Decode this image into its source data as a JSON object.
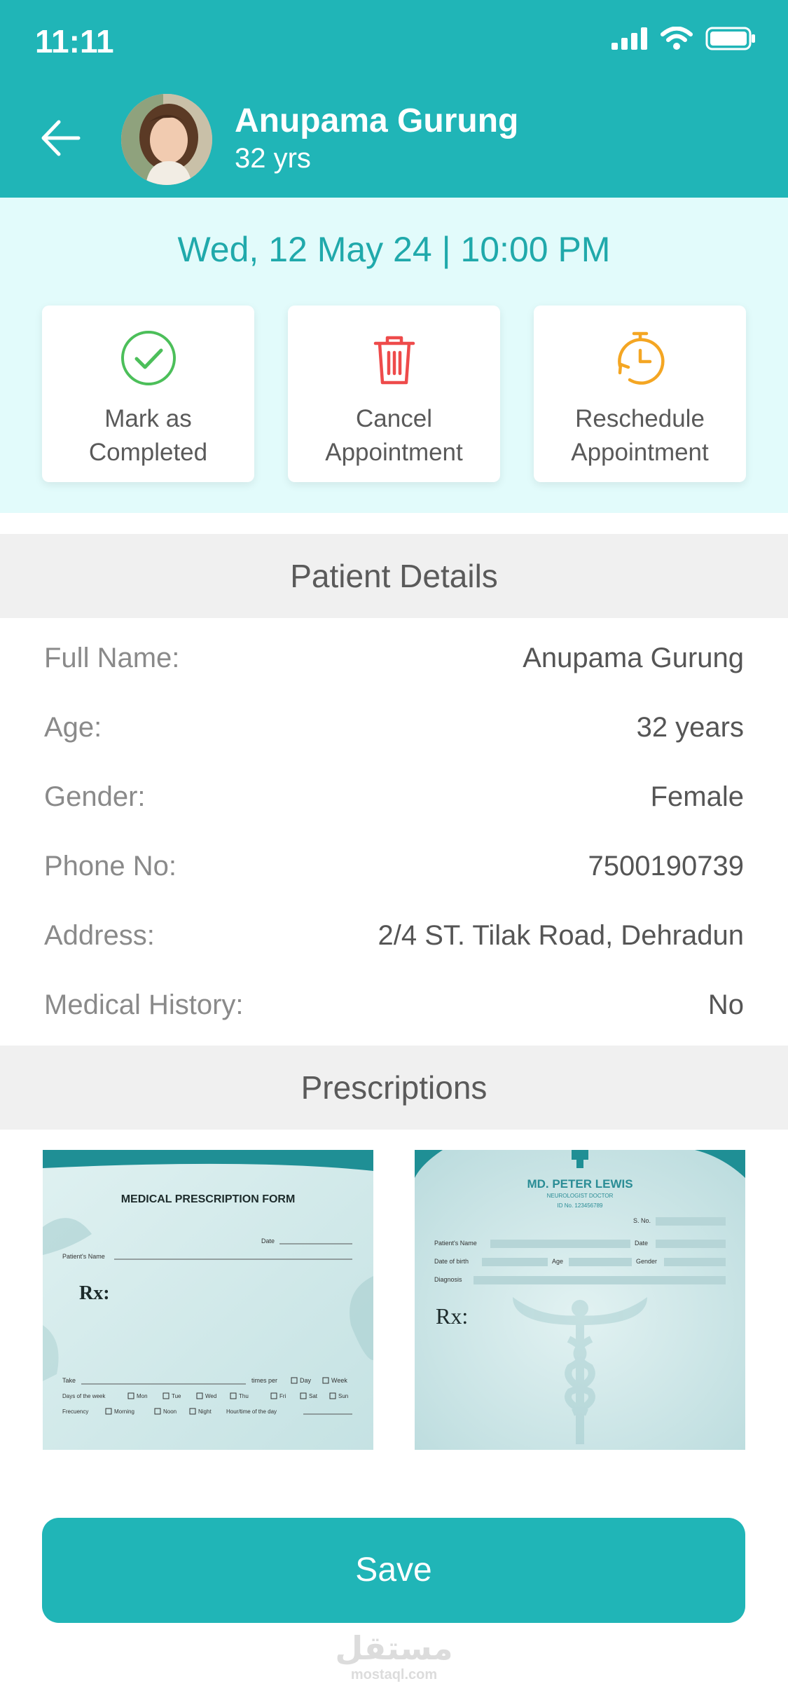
{
  "status_bar": {
    "time": "11:11"
  },
  "header": {
    "patient_name": "Anupama Gurung",
    "patient_age": "32 yrs"
  },
  "appointment": {
    "datetime": "Wed, 12 May 24 | 10:00 PM",
    "actions": [
      {
        "line1": "Mark as",
        "line2": "Completed",
        "icon": "check-circle-icon",
        "color": "#4cbf5a"
      },
      {
        "line1": "Cancel",
        "line2": "Appointment",
        "icon": "trash-icon",
        "color": "#ee4b4b"
      },
      {
        "line1": "Reschedule",
        "line2": "Appointment",
        "icon": "clock-reschedule-icon",
        "color": "#f4a623"
      }
    ]
  },
  "patient_details": {
    "title": "Patient Details",
    "rows": [
      {
        "label": "Full Name:",
        "value": "Anupama Gurung"
      },
      {
        "label": "Age:",
        "value": "32 years"
      },
      {
        "label": "Gender:",
        "value": "Female"
      },
      {
        "label": "Phone No:",
        "value": "7500190739"
      },
      {
        "label": "Address:",
        "value": "2/4 ST. Tilak Road, Dehradun"
      },
      {
        "label": "Medical History:",
        "value": "No"
      }
    ]
  },
  "prescriptions": {
    "title": "Prescriptions",
    "form1": {
      "title": "MEDICAL PRESCRIPTION FORM",
      "date_label": "Date",
      "patient_label": "Patient's Name",
      "rx": "Rx:",
      "take_label": "Take",
      "times_per": "times per",
      "day": "Day",
      "week": "Week",
      "days_label": "Days of the week",
      "days": [
        "Mon",
        "Tue",
        "Wed",
        "Thu",
        "Fri",
        "Sat",
        "Sun"
      ],
      "freq_label": "Frecuency",
      "freqs": [
        "Morning",
        "Noon",
        "Night"
      ],
      "hour_label": "Hour/time of the day"
    },
    "form2": {
      "doctor": "MD. PETER LEWIS",
      "specialty": "NEUROLOGIST DOCTOR",
      "id_no": "ID No. 123456789",
      "sno": "S. No.",
      "patient_label": "Patient's Name",
      "date_label": "Date",
      "dob_label": "Date of birth",
      "age_label": "Age",
      "gender_label": "Gender",
      "diagnosis_label": "Diagnosis",
      "rx": "Rx:"
    }
  },
  "save_label": "Save",
  "watermark": {
    "arabic": "مستقل",
    "latin": "mostaql.com"
  },
  "colors": {
    "primary": "#20b5b7",
    "band": "#e2fbfb"
  }
}
